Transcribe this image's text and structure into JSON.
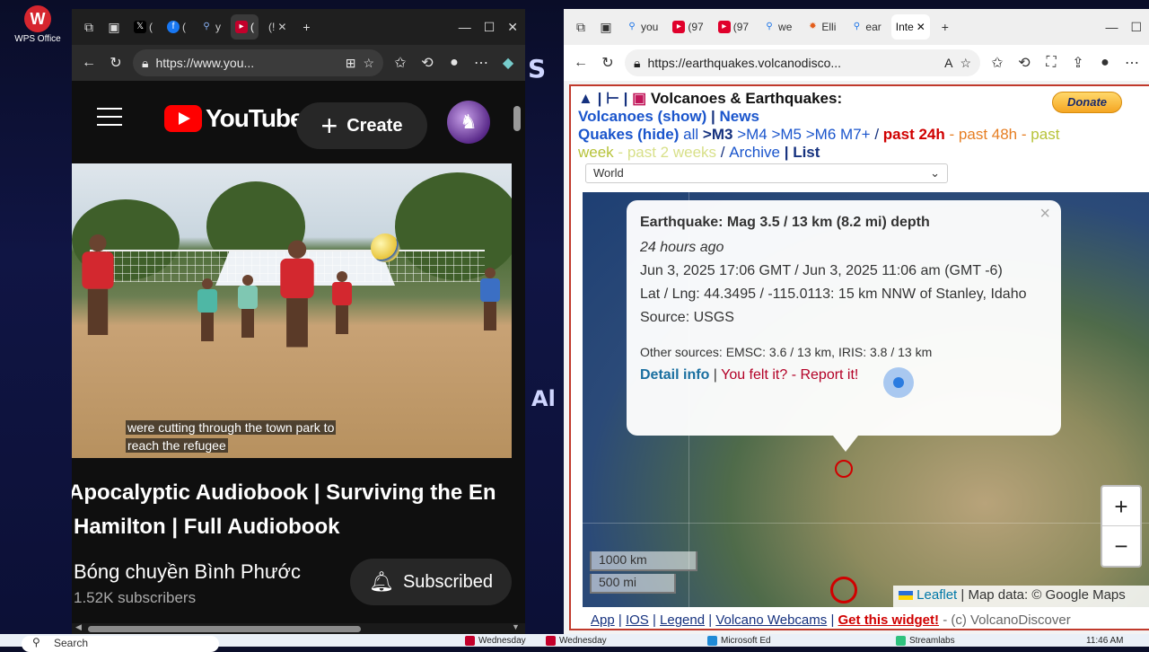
{
  "desktop": {
    "wps_label": "WPS Office",
    "wps_icon": "W",
    "bg_text_1": "S",
    "bg_text_2": "Al"
  },
  "left_browser": {
    "tabs": [
      {
        "icon": "x-icon",
        "label": "("
      },
      {
        "icon": "facebook-icon",
        "label": "("
      },
      {
        "icon": "search-icon",
        "label": "y"
      },
      {
        "icon": "youtube-icon",
        "label": "("
      },
      {
        "icon": "youtube-icon",
        "label": "(!"
      }
    ],
    "url": "https://www.you..."
  },
  "youtube": {
    "logo_text": "YouTube",
    "create_label": "Create",
    "create_icon": "+",
    "caption_line1": "were cutting through the town park to",
    "caption_line2": "reach the refugee",
    "title_line1": "Apocalyptic Audiobook | Surviving the En",
    "title_line2": "Hamilton | Full Audiobook",
    "channel": "Bóng chuyền Bình Phước",
    "subscribers": "1.52K subscribers",
    "subscribed_label": "Subscribed"
  },
  "right_browser": {
    "tabs": [
      {
        "icon": "search-icon",
        "label": "you"
      },
      {
        "icon": "youtube-icon",
        "label": "(97"
      },
      {
        "icon": "youtube-icon",
        "label": "(97"
      },
      {
        "icon": "search-icon",
        "label": "we"
      },
      {
        "icon": "sun-icon",
        "label": "Elli"
      },
      {
        "icon": "search-icon",
        "label": "ear"
      },
      {
        "icon": "page-icon",
        "label": "Inte"
      }
    ],
    "url": "https://earthquakes.volcanodisco..."
  },
  "volcanodiscovery": {
    "title": "Volcanoes & Earthquakes:",
    "nav_sep": "|",
    "donate": "Donate",
    "volcanoes": "Volcanoes (show)",
    "news": "News",
    "quakes": "Quakes (hide)",
    "mag_all": "all",
    "mag_m3": ">M3",
    "mag_m4": ">M4",
    "mag_m5": ">M5",
    "mag_m6": ">M6",
    "mag_m7": "M7+",
    "past24": "past 24h",
    "past48": "past 48h",
    "past_week_1": "past",
    "past_week_2": "week",
    "past2w": "past 2 weeks",
    "archive": "Archive",
    "list": "List",
    "region": "World"
  },
  "popup": {
    "title": "Earthquake: Mag 3.5 / 13 km (8.2 mi) depth",
    "ago": "24 hours ago",
    "time": "Jun 3, 2025 17:06 GMT / Jun 3, 2025 11:06 am (GMT -6)",
    "location": "Lat / Lng: 44.3495 / -115.0113: 15 km NNW of Stanley, Idaho",
    "source": "Source: USGS",
    "other_sources": "Other sources: EMSC: 3.6 / 13 km, IRIS: 3.8 / 13 km",
    "detail": "Detail info",
    "felt": "You felt it? - Report it!",
    "close": "×"
  },
  "map": {
    "zoom_in": "+",
    "zoom_out": "−",
    "scale_km": "1000 km",
    "scale_mi": "500 mi",
    "leaflet": "Leaflet",
    "attribution": "| Map data: © Google Maps"
  },
  "footer": {
    "app": "App",
    "ios": "IOS",
    "legend": "Legend",
    "webcams": "Volcano Webcams",
    "widget": "Get this widget!",
    "copyright": "- (c) VolcanoDiscover"
  },
  "taskbar": {
    "search_placeholder": "Search",
    "app1": "Wednesday",
    "app2": "Wednesday",
    "app3": "Microsoft Ed",
    "app4": "Streamlabs",
    "clock": "11:46 AM"
  },
  "colors": {
    "youtube_red": "#ff0000",
    "quake_red": "#d10000",
    "link_blue": "#15317e"
  }
}
